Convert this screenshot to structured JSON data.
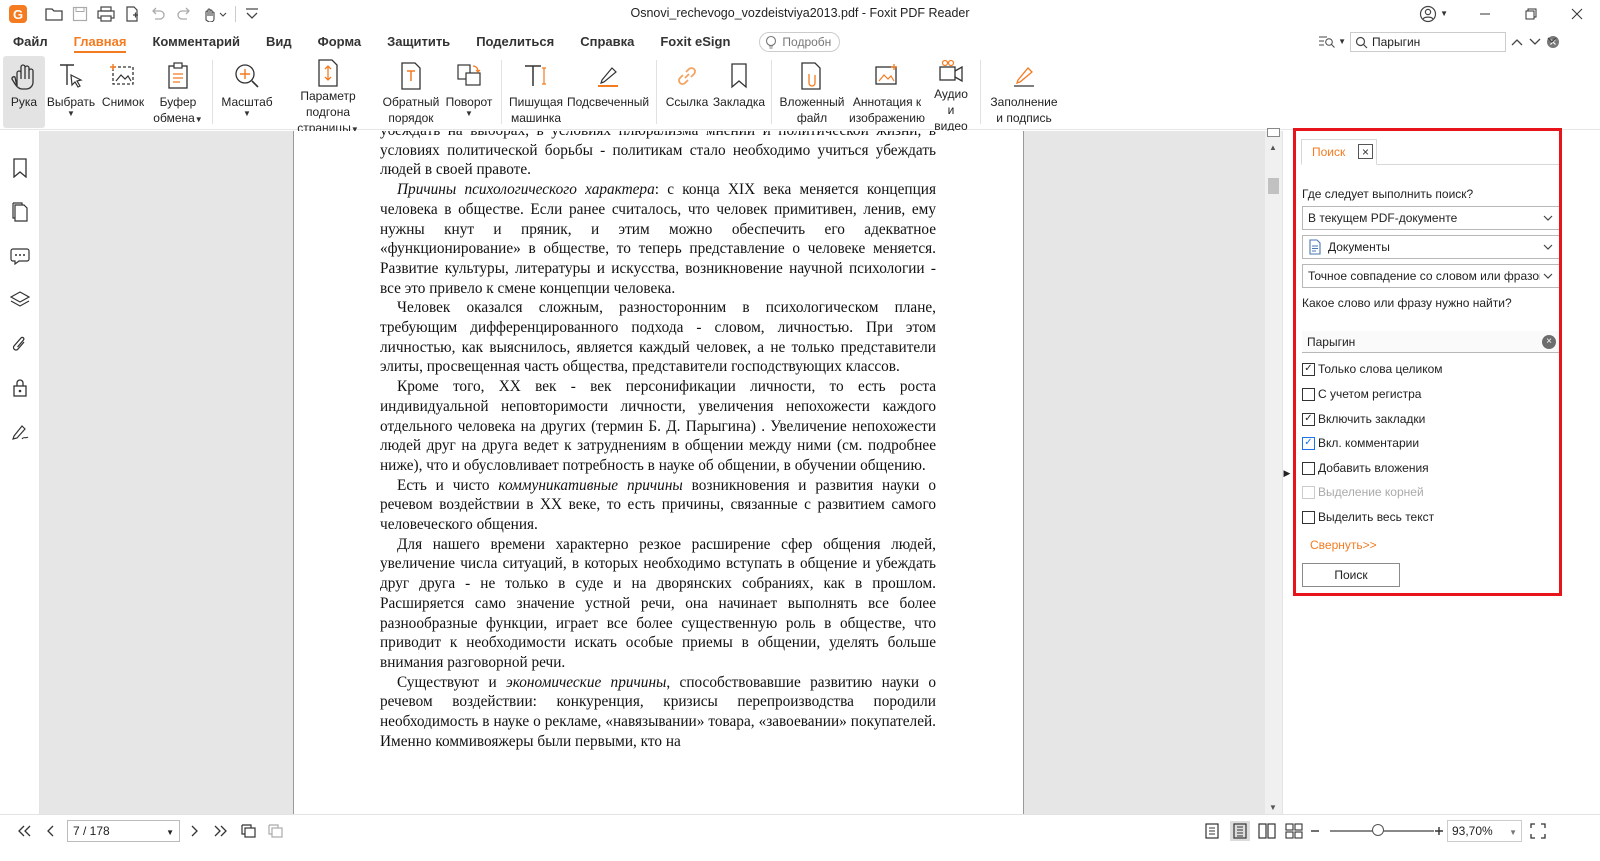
{
  "app": {
    "title": "Osnovi_rechevogo_vozdeistviya2013.pdf - Foxit PDF Reader",
    "logo_letter": "G",
    "accent_color": "#f47b20",
    "highlight_color": "#e8141c"
  },
  "menu": {
    "tabs": [
      "Файл",
      "Главная",
      "Комментарий",
      "Вид",
      "Форма",
      "Защитить",
      "Поделиться",
      "Справка",
      "Foxit eSign"
    ],
    "active_tab": "Главная",
    "help_search_placeholder": "Подробн",
    "top_search_value": "Парыгин"
  },
  "ribbon": {
    "hand": "Рука",
    "select": "Выбрать",
    "snapshot": "Снимок",
    "clipboard_1": "Буфер",
    "clipboard_2": "обмена",
    "zoom": "Масштаб",
    "page_fit_1": "Параметр подгона",
    "page_fit_2": "страницы",
    "reverse_1": "Обратный",
    "reverse_2": "порядок",
    "rotate": "Поворот",
    "typewriter_1": "Пишущая",
    "typewriter_2": "машинка",
    "highlighted": "Подсвеченный",
    "link": "Ссылка",
    "bookmark": "Закладка",
    "attached_1": "Вложенный",
    "attached_2": "файл",
    "image_annot_1": "Аннотация к",
    "image_annot_2": "изображению",
    "audio_video_1": "Аудио",
    "audio_video_2": "и видео",
    "fill_sign_1": "Заполнение",
    "fill_sign_2": "и подпись"
  },
  "document": {
    "paragraphs": [
      {
        "first": true,
        "text": "убеждать на  выборах, в условиях плюрализма мнений и политической жизни, в условиях политической  борьбы - политикам стало необходимо учиться убеждать людей в своей правоте."
      },
      {
        "italic_lead": "Причины психологического характера",
        "text": ": с конца XIX века меняется концепция человека в обществе. Если ранее считалось, что человек примитивен, ленив, ему нужны кнут и пряник, и этим можно обеспечить его адекватное «функционирование» в обществе, то теперь представление о человеке меняется. Развитие культуры, литературы и искусства, возникновение научной психологии  -  все это привело к смене концепции человека."
      },
      {
        "text": "Человек оказался сложным, разносторонним в психологическом плане, требующим дифференцированного подхода - словом, личностью. При этом личностью, как выяснилось, является каждый человек, а не только представители элиты, просвещенная часть общества, представители господствующих классов."
      },
      {
        "text": "Кроме того, XX век - век персонификации личности, то есть роста индивидуальной неповторимости личности, увеличения непохожести каждого отдельного человека на других (термин Б. Д. Парыгина) . Увеличение непохожести людей друг на друга ведет к затруднениям в общении между ними (см. подробнее ниже), что и обусловливает потребность в науке об общении, в обучении общению."
      },
      {
        "pre": "Есть и чисто ",
        "italic_mid": "коммуникативные причины",
        "text": " возникновения и развития науки о речевом воздействии в XX веке, то есть причины, связанные с развитием самого человеческого общения."
      },
      {
        "text": "Для нашего времени характерно резкое расширение сфер общения людей, увеличение числа ситуаций, в которых необходимо вступать в общение и убеждать друг друга - не только в суде и на дворянских собраниях, как в прошлом. Расширяется само значение устной  речи, она начинает выполнять все более разнообразные функции, играет все более существенную роль в обществе, что приводит к необходимости искать особые приемы в общении, уделять больше внимания разговорной речи."
      },
      {
        "pre": "Существуют и ",
        "italic_mid": "экономические причины",
        "text": ", способствовавшие развитию науки о речевом воздействии: конкуренция, кризисы перепроизводства породили необходимость в науке о рекламе, «навязывании» товара, «завоевании» покупателей. Именно коммивояжеры были первыми, кто на"
      }
    ]
  },
  "search_panel": {
    "tab_label": "Поиск",
    "where_label": "Где следует выполнить поиск?",
    "scope_value": "В текущем PDF-документе",
    "folder_value": "Документы",
    "match_value": "Точное совпадение со словом или фразой",
    "what_label": "Какое слово или фразу нужно найти?",
    "query_value": "Парыгин",
    "options": [
      {
        "label": "Только слова целиком",
        "checked": true,
        "disabled": false
      },
      {
        "label": "С учетом регистра",
        "checked": false,
        "disabled": false
      },
      {
        "label": "Включить закладки",
        "checked": true,
        "disabled": false
      },
      {
        "label": "Вкл. комментарии",
        "checked": true,
        "disabled": false
      },
      {
        "label": "Добавить вложения",
        "checked": false,
        "disabled": false
      },
      {
        "label": "Выделение корней",
        "checked": false,
        "disabled": true
      },
      {
        "label": "Выделить весь текст",
        "checked": false,
        "disabled": false
      }
    ],
    "collapse_link": "Свернуть>>",
    "search_button": "Поиск"
  },
  "status": {
    "page_indicator": "7 / 178",
    "zoom_value": "93,70%",
    "zoom_fraction": 0.42
  }
}
